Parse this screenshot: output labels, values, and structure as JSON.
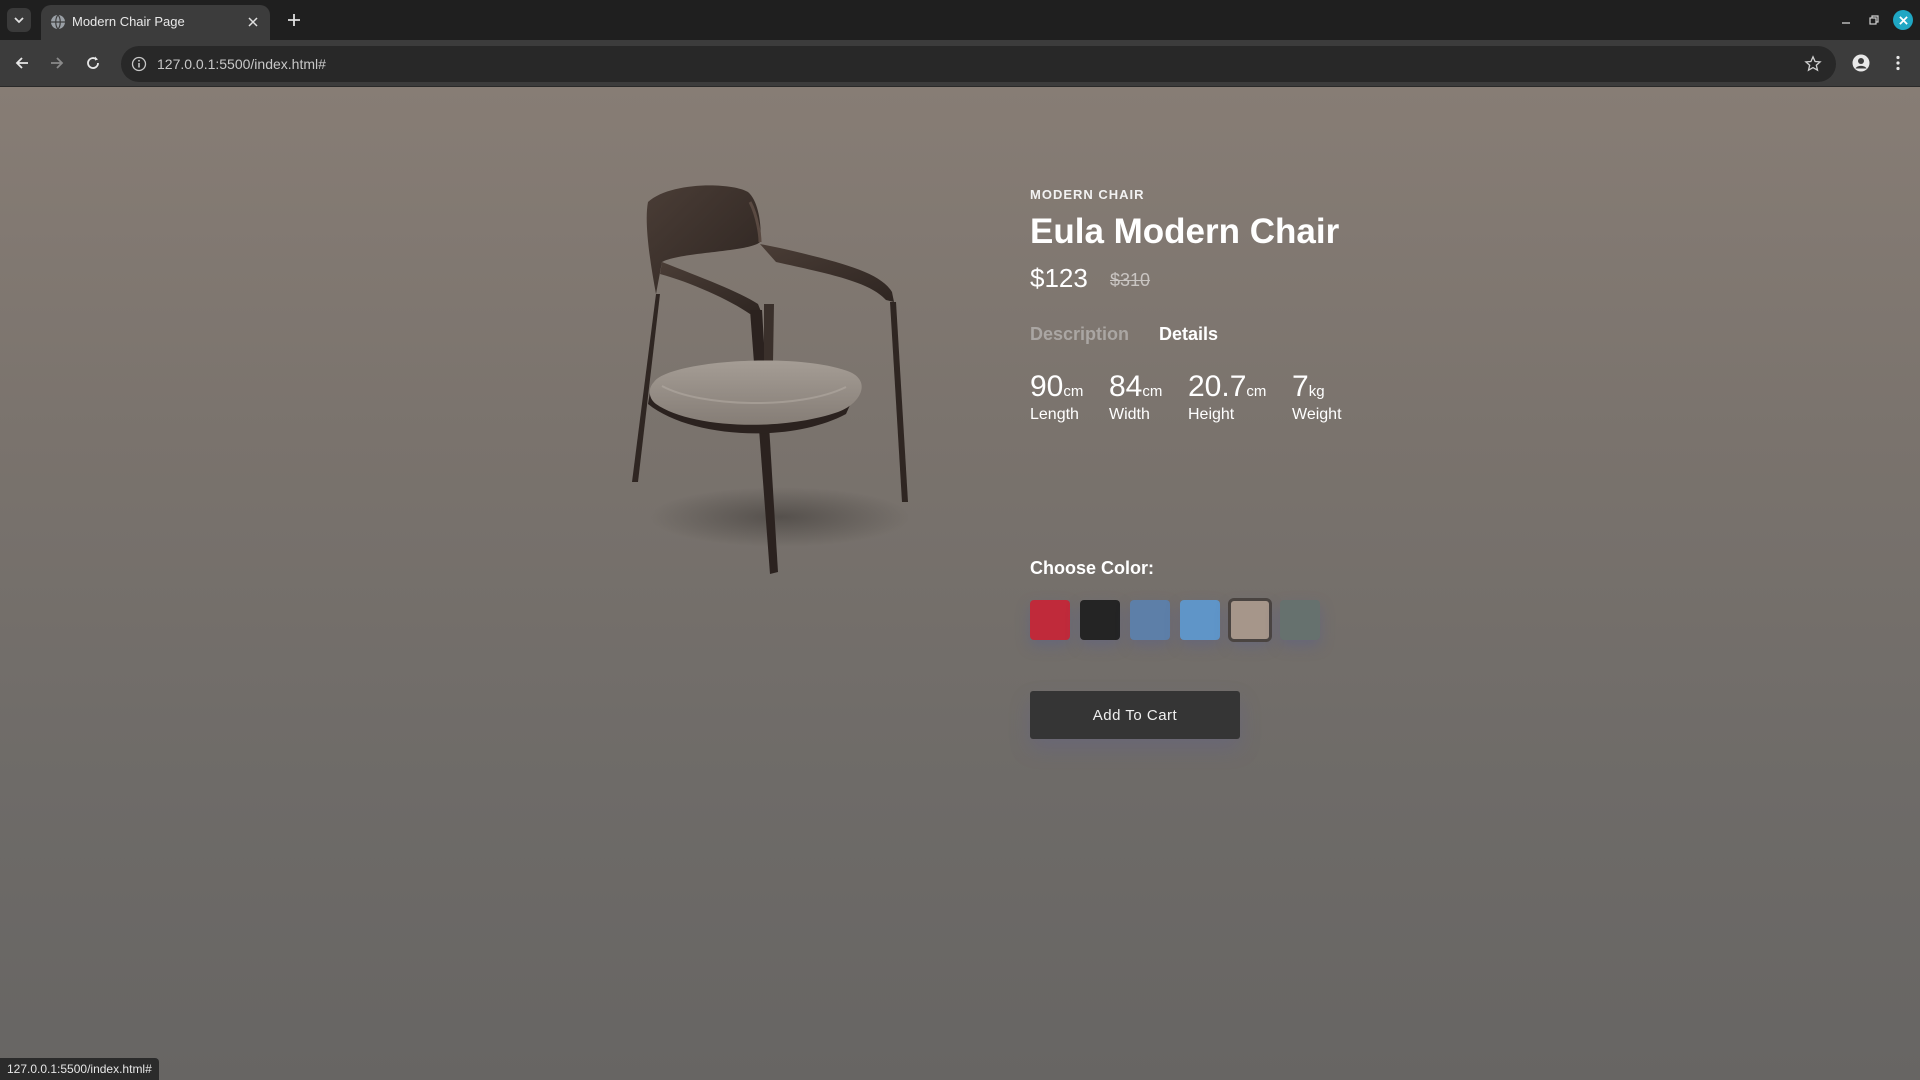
{
  "browser": {
    "tab_title": "Modern Chair Page",
    "url": "127.0.0.1:5500/index.html#",
    "status_url": "127.0.0.1:5500/index.html#"
  },
  "product": {
    "category": "MODERN CHAIR",
    "name": "Eula Modern Chair",
    "price": "$123",
    "old_price": "$310",
    "tabs": {
      "description": "Description",
      "details": "Details",
      "active": "details"
    },
    "specs": [
      {
        "value": "90",
        "unit": "cm",
        "label": "Length"
      },
      {
        "value": "84",
        "unit": "cm",
        "label": "Width"
      },
      {
        "value": "20.7",
        "unit": "cm",
        "label": "Height"
      },
      {
        "value": "7",
        "unit": "kg",
        "label": "Weight"
      }
    ],
    "choose_color_label": "Choose Color:",
    "colors": [
      {
        "name": "red",
        "hex": "#c02a3a"
      },
      {
        "name": "black",
        "hex": "#242424"
      },
      {
        "name": "blue-denim",
        "hex": "#5d7fa8"
      },
      {
        "name": "light-blue",
        "hex": "#5f95c8"
      },
      {
        "name": "beige",
        "hex": "#a6968a",
        "selected": true
      },
      {
        "name": "grey-green",
        "hex": "#66716e"
      }
    ],
    "add_to_cart": "Add To Cart"
  },
  "theme": {
    "page_bg_top": "#877d75",
    "page_bg_bottom": "#676563",
    "button_bg": "#353535"
  }
}
